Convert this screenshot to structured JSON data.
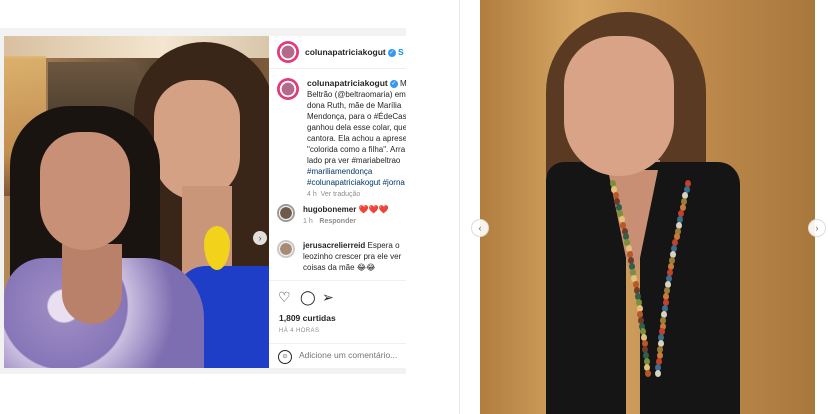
{
  "post": {
    "username": "colunapatriciakogut",
    "follow_label": "S",
    "caption": {
      "lines": [
        "Ma",
        "Beltrão (@beltraomaria) em",
        "dona Ruth, mãe de Marília",
        "Mendonça, para o #ÉdeCas",
        "ganhou dela esse colar, que",
        "cantora. Ela achou a aprese",
        "\"colorida como a filha\". Arra",
        "lado pra ver #mariabeltrao",
        "#mariliamendonça",
        "#colunapatriciakogut #jorna"
      ],
      "time": "4 h",
      "translate": "Ver tradução"
    },
    "comments": [
      {
        "username": "hugobonemer",
        "text": "❤️❤️❤️",
        "time": "1 h",
        "reply": "Responder"
      },
      {
        "username": "jerusacrelierreid",
        "text": "Espera o leozinho crescer pra ele ver coisas da mãe 😂😂"
      }
    ],
    "likes": "1,809 curtidas",
    "posted": "HÁ 4 HORAS",
    "add_comment_placeholder": "Adicione um comentário..."
  },
  "icons": {
    "like": "heart-icon",
    "comment": "comment-bubble-icon",
    "share": "paper-plane-icon",
    "emoji": "smiley-icon",
    "next": "chevron-right-icon",
    "prev": "chevron-left-icon",
    "tag": "user-tag-icon"
  },
  "colors": {
    "link": "#00376b",
    "follow": "#0095f6",
    "verified": "#3897f0"
  }
}
